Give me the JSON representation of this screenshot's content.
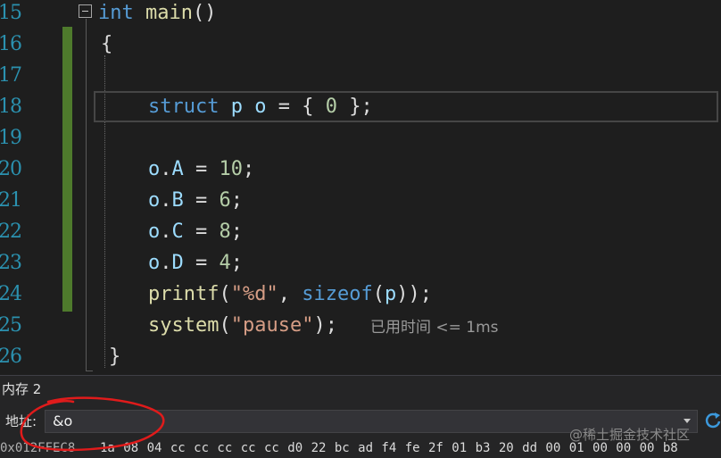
{
  "editor": {
    "lines": [
      {
        "number": "15",
        "tokens": [
          {
            "t": "int",
            "c": "kw"
          },
          {
            "t": " ",
            "c": "punc"
          },
          {
            "t": "main",
            "c": "fn"
          },
          {
            "t": "()",
            "c": "punc"
          }
        ]
      },
      {
        "number": "16",
        "tokens": [
          {
            "t": "{",
            "c": "punc"
          }
        ]
      },
      {
        "number": "17",
        "tokens": []
      },
      {
        "number": "18",
        "tokens": [
          {
            "t": "struct",
            "c": "kw"
          },
          {
            "t": " ",
            "c": "punc"
          },
          {
            "t": "p",
            "c": "var"
          },
          {
            "t": " ",
            "c": "punc"
          },
          {
            "t": "o",
            "c": "var"
          },
          {
            "t": " = { ",
            "c": "punc"
          },
          {
            "t": "0",
            "c": "num"
          },
          {
            "t": " };",
            "c": "punc"
          }
        ]
      },
      {
        "number": "19",
        "tokens": []
      },
      {
        "number": "20",
        "tokens": [
          {
            "t": "o",
            "c": "var"
          },
          {
            "t": ".",
            "c": "punc"
          },
          {
            "t": "A",
            "c": "var"
          },
          {
            "t": " = ",
            "c": "punc"
          },
          {
            "t": "10",
            "c": "num"
          },
          {
            "t": ";",
            "c": "punc"
          }
        ]
      },
      {
        "number": "21",
        "tokens": [
          {
            "t": "o",
            "c": "var"
          },
          {
            "t": ".",
            "c": "punc"
          },
          {
            "t": "B",
            "c": "var"
          },
          {
            "t": " = ",
            "c": "punc"
          },
          {
            "t": "6",
            "c": "num"
          },
          {
            "t": ";",
            "c": "punc"
          }
        ]
      },
      {
        "number": "22",
        "tokens": [
          {
            "t": "o",
            "c": "var"
          },
          {
            "t": ".",
            "c": "punc"
          },
          {
            "t": "C",
            "c": "var"
          },
          {
            "t": " = ",
            "c": "punc"
          },
          {
            "t": "8",
            "c": "num"
          },
          {
            "t": ";",
            "c": "punc"
          }
        ]
      },
      {
        "number": "23",
        "tokens": [
          {
            "t": "o",
            "c": "var"
          },
          {
            "t": ".",
            "c": "punc"
          },
          {
            "t": "D",
            "c": "var"
          },
          {
            "t": " = ",
            "c": "punc"
          },
          {
            "t": "4",
            "c": "num"
          },
          {
            "t": ";",
            "c": "punc"
          }
        ]
      },
      {
        "number": "24",
        "tokens": [
          {
            "t": "printf",
            "c": "fn"
          },
          {
            "t": "(",
            "c": "punc"
          },
          {
            "t": "\"%d\"",
            "c": "str"
          },
          {
            "t": ", ",
            "c": "punc"
          },
          {
            "t": "sizeof",
            "c": "kw"
          },
          {
            "t": "(",
            "c": "punc"
          },
          {
            "t": "p",
            "c": "var"
          },
          {
            "t": "));",
            "c": "punc"
          }
        ]
      },
      {
        "number": "25",
        "tokens": [
          {
            "t": "system",
            "c": "fn"
          },
          {
            "t": "(",
            "c": "punc"
          },
          {
            "t": "\"pause\"",
            "c": "str"
          },
          {
            "t": ");",
            "c": "punc"
          }
        ]
      },
      {
        "number": "26",
        "tokens": [
          {
            "t": "}",
            "c": "punc"
          }
        ]
      }
    ],
    "perf_tip": "已用时间 <= 1ms"
  },
  "memory_panel": {
    "title": "内存 2",
    "address_label": "地址:",
    "address_value": "&o",
    "row_address": "0x012FFEC8",
    "row_bytes": "1a 08 04 cc cc cc cc cc d0 22 bc ad f4 fe 2f 01 b3 20 dd 00 01 00 00 00 b8"
  },
  "watermark": "@稀土掘金技术社区",
  "colors": {
    "change_bar": "#4e7a2c",
    "annotation_circle": "#e01b1b",
    "line_number": "#2b91af"
  },
  "icons": {
    "fold": "collapse-minus-icon",
    "refresh": "refresh-icon",
    "dropdown": "chevron-down-icon"
  }
}
